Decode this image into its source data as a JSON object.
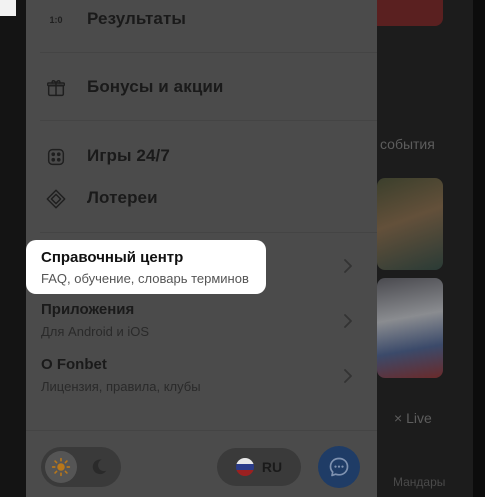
{
  "background": {
    "section_label": "события",
    "live_label": "Live",
    "bottom_text": "Мандары"
  },
  "menu": {
    "items": [
      {
        "label": "Результаты",
        "icon": "score-icon",
        "icon_text": "1:0"
      },
      {
        "label": "Бонусы и акции",
        "icon": "gift-icon"
      },
      {
        "label": "Игры 24/7",
        "icon": "dice-icon"
      },
      {
        "label": "Лотереи",
        "icon": "ticket-icon"
      }
    ]
  },
  "info": {
    "help": {
      "title": "Справочный центр",
      "subtitle": "FAQ, обучение, словарь терминов"
    },
    "apps": {
      "title": "Приложения",
      "subtitle": "Для Android и iOS"
    },
    "about": {
      "title": "О Fonbet",
      "subtitle": "Лицензия, правила, клубы"
    }
  },
  "footer": {
    "theme_active": "light",
    "language": "RU",
    "chat_icon": "chat-bubble-icon",
    "accent_color": "#1f3c66"
  }
}
